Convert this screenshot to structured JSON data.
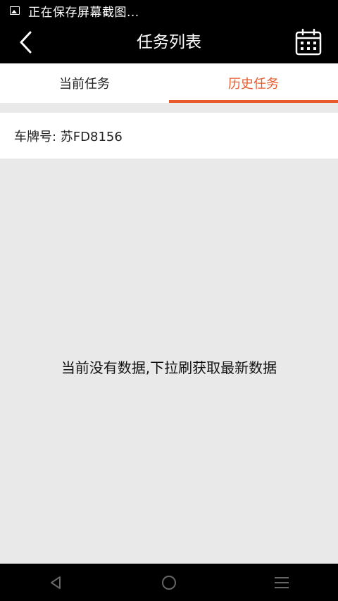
{
  "status_bar": {
    "notification_text": "正在保存屏幕截图..."
  },
  "app_bar": {
    "title": "任务列表",
    "back_icon": "back-arrow-icon",
    "calendar_icon": "calendar-icon"
  },
  "tabs": [
    {
      "label": "当前任务",
      "active": false
    },
    {
      "label": "历史任务",
      "active": true
    }
  ],
  "plate": {
    "label": "车牌号: 苏FD8156"
  },
  "empty_state": {
    "message": "当前没有数据,下拉刷获取最新数据"
  },
  "nav_bar": {
    "back_icon": "nav-back-icon",
    "home_icon": "nav-home-icon",
    "menu_icon": "nav-menu-icon"
  },
  "colors": {
    "accent": "#e8592c",
    "header_bg": "#000000",
    "content_bg": "#e9e9e9"
  }
}
